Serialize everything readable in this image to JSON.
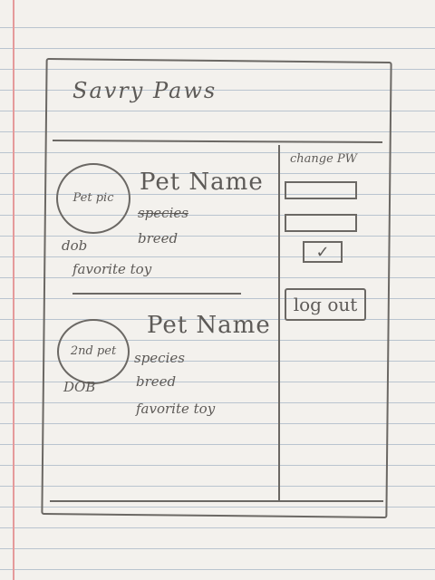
{
  "app": {
    "title": "Savry Paws"
  },
  "pets": [
    {
      "pic_label": "Pet pic",
      "name": "Pet Name",
      "species": "species",
      "breed": "breed",
      "dob": "dob",
      "favorite_toy": "favorite toy"
    },
    {
      "pic_label": "2nd pet",
      "name": "Pet Name",
      "species": "species",
      "breed": "breed",
      "dob": "DOB",
      "favorite_toy": "favorite toy"
    }
  ],
  "sidebar": {
    "change_pw_label": "change PW",
    "pw_field_1": "",
    "pw_field_2": "",
    "submit_icon": "checkmark-icon",
    "submit_symbol": "✓",
    "logout_label": "log out"
  }
}
